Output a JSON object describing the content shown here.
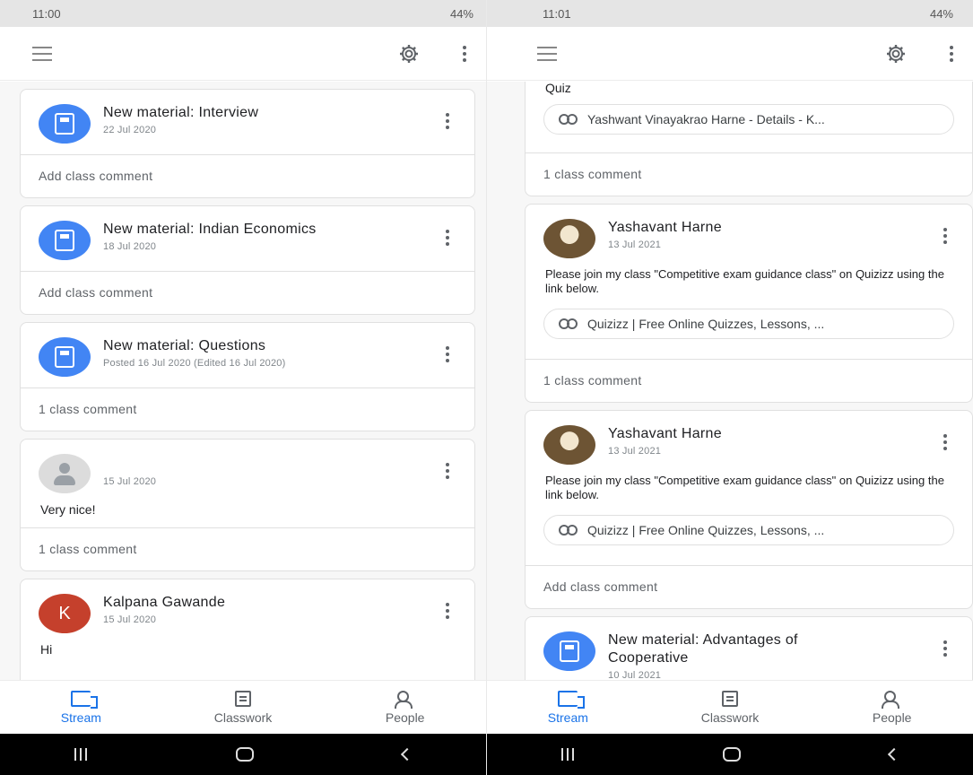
{
  "left": {
    "status": {
      "time": "11:00",
      "right": "44%"
    },
    "cards": [
      {
        "title": "New material: Interview",
        "date": "22 Jul 2020",
        "footer": "Add class comment"
      },
      {
        "title": "New material: Indian Economics",
        "date": "18 Jul 2020",
        "footer": "Add class comment"
      },
      {
        "title": "New material: Questions",
        "date": "Posted 16 Jul 2020 (Edited 16 Jul 2020)",
        "footer": "1 class comment"
      },
      {
        "date": "15 Jul 2020",
        "body": "Very nice!",
        "footer": "1 class comment"
      },
      {
        "avatar_letter": "K",
        "title": "Kalpana Gawande",
        "date": "15 Jul 2020",
        "body": "Hi"
      }
    ]
  },
  "right": {
    "status": {
      "time": "11:01",
      "right": "44%"
    },
    "cards": [
      {
        "top_text": "Quiz",
        "link": "Yashwant Vinayakrao Harne - Details - K...",
        "footer": "1 class comment"
      },
      {
        "title": "Yashavant Harne",
        "date": "13 Jul 2021",
        "body": "Please join my class \"Competitive exam guidance class\" on Quizizz using the link below.",
        "link": "Quizizz | Free Online Quizzes, Lessons, ...",
        "footer": "1 class comment"
      },
      {
        "title": "Yashavant Harne",
        "date": "13 Jul 2021",
        "body": "Please join my class \"Competitive exam guidance class\" on Quizizz using the link below.",
        "link": "Quizizz | Free Online Quizzes, Lessons, ...",
        "footer": "Add class comment"
      },
      {
        "title": "New material: Advantages of Cooperative",
        "date": "10 Jul 2021"
      }
    ]
  },
  "nav": {
    "stream": "Stream",
    "classwork": "Classwork",
    "people": "People"
  },
  "colors": {
    "accent": "#1a73e8",
    "material_avatar": "#4285f4",
    "letter_avatar": "#c5402c"
  }
}
